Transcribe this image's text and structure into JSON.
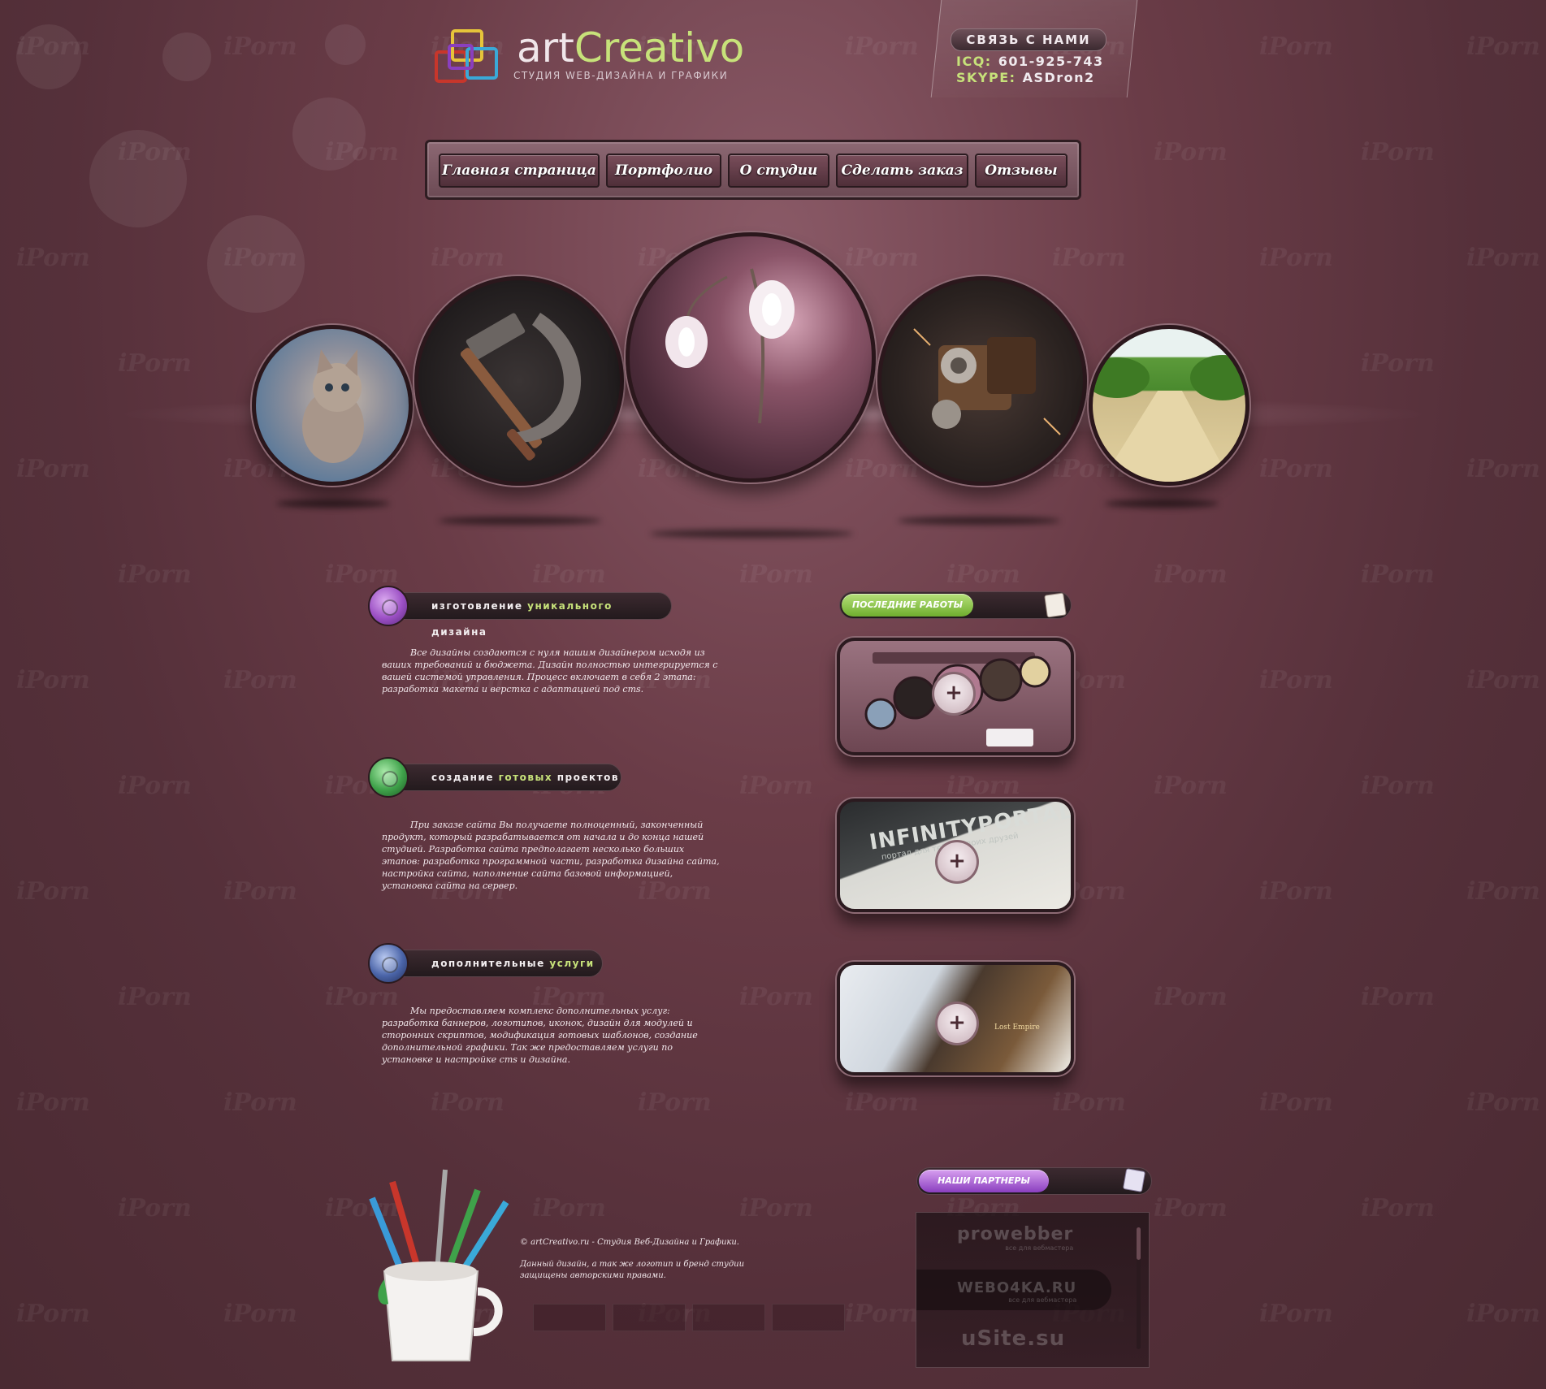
{
  "header": {
    "logo_text_main": "art",
    "logo_text_accent": "Creativo",
    "tagline": "Студия Web-дизайна и графики",
    "contact": {
      "title": "Связь с нами",
      "icq_label": "ICQ:",
      "icq_value": "601-925-743",
      "skype_label": "SKYPE:",
      "skype_value": "ASDron2"
    }
  },
  "nav": {
    "items": [
      {
        "label": "Главная страница"
      },
      {
        "label": "Портфолио"
      },
      {
        "label": "О студии"
      },
      {
        "label": "Сделать заказ"
      },
      {
        "label": "Отзывы"
      }
    ]
  },
  "watermark": "iPorn",
  "sections": [
    {
      "title_pre": "изготовление",
      "title_hl": "уникального",
      "title_post": "дизайна",
      "orb_color": "#9b4fc4",
      "text": "Все дизайны создаются с нуля нашим дизайнером исходя из ваших требований и бюджета. Дизайн полностью интегрируется с вашей системой управления. Процесс включает в себя 2 этапа: разработка макета и верстка с адаптацией под cms."
    },
    {
      "title_pre": "создание",
      "title_hl": "готовых",
      "title_post": "проектов",
      "orb_color": "#3fa24a",
      "text": "При заказе сайта Вы получаете полноценный, законченный продукт, который разрабатывается от начала и до конца нашей студией. Разработка сайта предполагает несколько больших этапов: разработка программной части, разработка дизайна сайта, настройка сайта, наполнение сайта базовой информацией, установка сайта на сервер."
    },
    {
      "title_pre": "дополнительные",
      "title_hl": "услуги",
      "title_post": "",
      "orb_color": "#4a64a8",
      "text": "Мы предоставляем комплекс дополнительных услуг: разработка баннеров, логотипов, иконок, дизайн для модулей и сторонних скриптов, модификация готовых шаблонов, создание дополнительной графики. Так же предоставляем услуги по установке и настройке cms и дизайна."
    }
  ],
  "works": {
    "title": "Последние работы",
    "card2_text": "INFINITYPORTAL",
    "card2_sub": "портал для тебя и твоих друзей",
    "card3_text": "Lost Empire"
  },
  "partners": {
    "title": "Наши партнеры",
    "items": [
      {
        "name": "prowebber",
        "sub": "все для вебмастера"
      },
      {
        "name": "WEBO4KA.RU",
        "sub": "все для вебмастера"
      },
      {
        "name": "uSite.su",
        "sub": ""
      }
    ]
  },
  "footer": {
    "copyright": "© artCreativo.ru - Студия Веб-Дизайна и Графики.",
    "rights": "Данный дизайн, а так же логотип и бренд студии защищены авторскими правами."
  },
  "colors": {
    "accent_green": "#c7e27a",
    "bg": "#55303a",
    "works_pill": "#7fbf3a",
    "partners_pill": "#9b4fc4"
  }
}
